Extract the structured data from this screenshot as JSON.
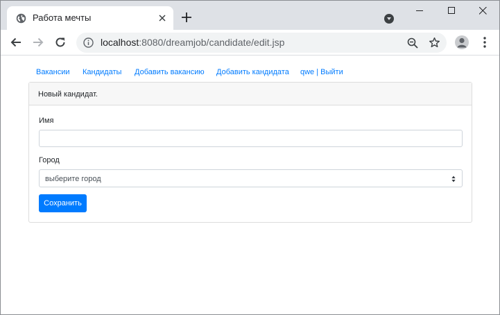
{
  "browser": {
    "tab_title": "Работа мечты",
    "url_host": "localhost",
    "url_rest": ":8080/dreamjob/candidate/edit.jsp",
    "icons": {
      "favicon": "globe-icon",
      "tab_close": "close-icon",
      "new_tab": "plus-icon",
      "tab_search": "chevron-down-icon",
      "minimize": "minimize-icon",
      "maximize": "maximize-icon",
      "close_window": "close-icon",
      "back": "arrow-left-icon",
      "forward": "arrow-right-icon",
      "reload": "reload-icon",
      "site_info": "info-icon",
      "zoom": "zoom-icon",
      "bookmark": "star-icon",
      "profile": "avatar-icon",
      "menu": "more-vert-icon"
    }
  },
  "nav": {
    "vacancies": "Вакансии",
    "candidates": "Кандидаты",
    "add_vacancy": "Добавить вакансию",
    "add_candidate": "Добавить кандидата",
    "user_logout": "qwe | Выйти"
  },
  "form": {
    "header": "Новый кандидат.",
    "name_label": "Имя",
    "name_value": "",
    "city_label": "Город",
    "city_selected": "выберите город",
    "submit_label": "Сохранить"
  },
  "colors": {
    "link": "#007bff",
    "primary_button": "#007bff",
    "tabstrip": "#dee1e6"
  }
}
